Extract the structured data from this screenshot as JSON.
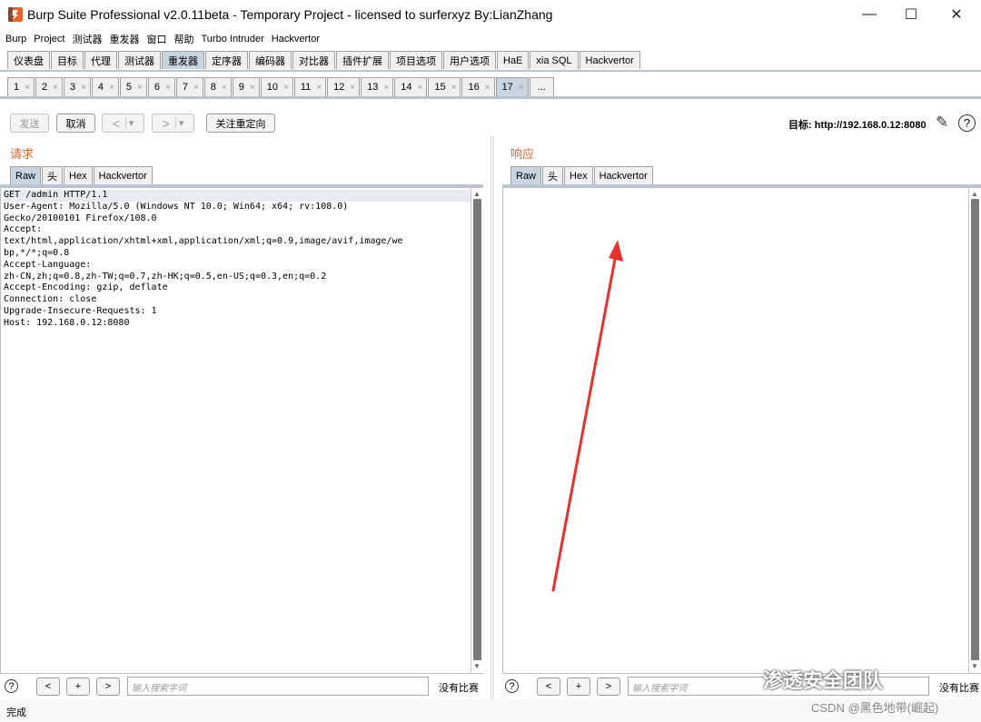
{
  "window": {
    "title": "Burp Suite Professional v2.0.11beta - Temporary Project - licensed to surferxyz By:LianZhang",
    "minimize": "—",
    "maximize": "☐",
    "close": "✕"
  },
  "menu": [
    "Burp",
    "Project",
    "测试器",
    "重发器",
    "窗口",
    "帮助",
    "Turbo Intruder",
    "Hackvertor"
  ],
  "main_tabs": [
    "仪表盘",
    "目标",
    "代理",
    "测试器",
    "重发器",
    "定序器",
    "编码器",
    "对比器",
    "插件扩展",
    "项目选项",
    "用户选项",
    "HaE",
    "xia SQL",
    "Hackvertor"
  ],
  "main_tab_active": 4,
  "repeater_tabs": [
    "1",
    "2",
    "3",
    "4",
    "5",
    "6",
    "7",
    "8",
    "9",
    "10",
    "11",
    "12",
    "13",
    "14",
    "15",
    "16",
    "17"
  ],
  "repeater_tab_active": 16,
  "repeater_more": "...",
  "tab_close": "×",
  "toolbar": {
    "send": "发送",
    "cancel": "取消",
    "back": "<",
    "forward": ">",
    "dropdown": "▾",
    "follow_redirect": "关注重定向",
    "target": "目标: http://192.168.0.12:8080",
    "edit_icon": "✎",
    "help_icon": "?"
  },
  "request": {
    "title": "请求",
    "tabs": [
      "Raw",
      "头",
      "Hex",
      "Hackvertor"
    ],
    "lines": [
      "GET /admin HTTP/1.1",
      "User-Agent: Mozilla/5.0 (Windows NT 10.0; Win64; x64; rv:108.0)",
      "Gecko/20100101 Firefox/108.0",
      "Accept:",
      "text/html,application/xhtml+xml,application/xml;q=0.9,image/avif,image/we",
      "bp,*/*;q=0.8",
      "Accept-Language:",
      "zh-CN,zh;q=0.8,zh-TW;q=0.7,zh-HK;q=0.5,en-US;q=0.3,en;q=0.2",
      "Accept-Encoding: gzip, deflate",
      "Connection: close",
      "Upgrade-Insecure-Requests: 1",
      "Host: 192.168.0.12:8080"
    ]
  },
  "response": {
    "title": "响应",
    "tabs": [
      "Raw",
      "头",
      "Hex",
      "Hackvertor"
    ]
  },
  "search": {
    "help": "?",
    "prev": "<",
    "add": "+",
    "next": ">",
    "placeholder": "输入搜索字词",
    "no_match": "没有比赛"
  },
  "status": "完成",
  "watermark": {
    "wechat": "渗透安全团队",
    "csdn": "CSDN @黑色地带(崛起)"
  },
  "colors": {
    "accent_orange": "#e8632c",
    "tab_active": "#c8d4e0",
    "annotation_arrow": "#e8312a"
  }
}
